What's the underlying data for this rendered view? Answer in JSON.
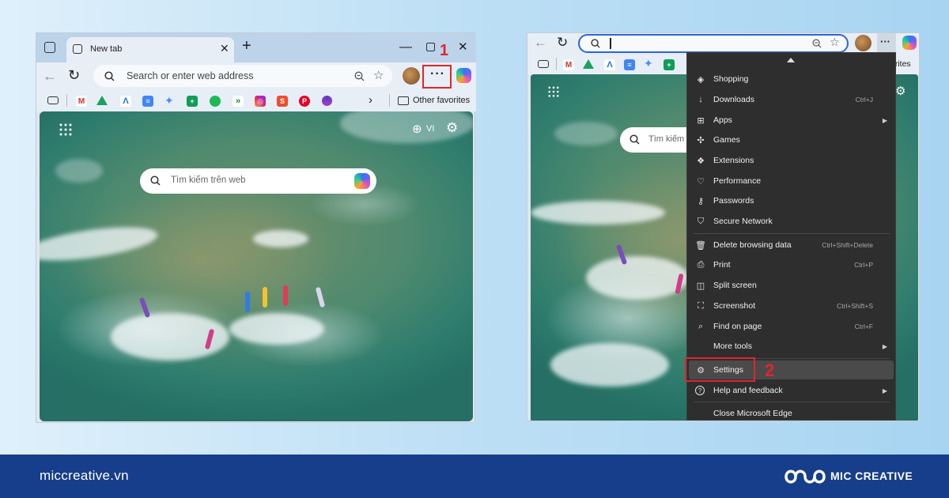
{
  "left_window": {
    "tab_title": "New tab",
    "address_placeholder": "Search or enter web address",
    "other_favorites": "Other favorites",
    "search_placeholder": "Tìm kiếm trên web",
    "language": "VI",
    "step_label": "1"
  },
  "right_window": {
    "search_placeholder": "Tìm kiếm",
    "fav_partial": "orites",
    "step_label": "2",
    "menu": {
      "items": [
        {
          "label": "Shopping",
          "icon": "tag-icon",
          "shortcut": "",
          "submenu": false
        },
        {
          "label": "Downloads",
          "icon": "download-icon",
          "shortcut": "Ctrl+J",
          "submenu": false
        },
        {
          "label": "Apps",
          "icon": "apps-icon",
          "shortcut": "",
          "submenu": true
        },
        {
          "label": "Games",
          "icon": "gamepad-icon",
          "shortcut": "",
          "submenu": false
        },
        {
          "label": "Extensions",
          "icon": "puzzle-icon",
          "shortcut": "",
          "submenu": false
        },
        {
          "label": "Performance",
          "icon": "heartbeat-icon",
          "shortcut": "",
          "submenu": false
        },
        {
          "label": "Passwords",
          "icon": "key-icon",
          "shortcut": "",
          "submenu": false
        },
        {
          "label": "Secure Network",
          "icon": "shield-icon",
          "shortcut": "",
          "submenu": false
        },
        {
          "label": "Delete browsing data",
          "icon": "trash-icon",
          "shortcut": "Ctrl+Shift+Delete",
          "submenu": false
        },
        {
          "label": "Print",
          "icon": "printer-icon",
          "shortcut": "Ctrl+P",
          "submenu": false
        },
        {
          "label": "Split screen",
          "icon": "split-screen-icon",
          "shortcut": "",
          "submenu": false
        },
        {
          "label": "Screenshot",
          "icon": "screenshot-icon",
          "shortcut": "Ctrl+Shift+S",
          "submenu": false
        },
        {
          "label": "Find on page",
          "icon": "find-icon",
          "shortcut": "Ctrl+F",
          "submenu": false
        },
        {
          "label": "More tools",
          "icon": "",
          "shortcut": "",
          "submenu": true
        },
        {
          "label": "Settings",
          "icon": "gear-icon",
          "shortcut": "",
          "submenu": false
        },
        {
          "label": "Help and feedback",
          "icon": "help-icon",
          "shortcut": "",
          "submenu": true
        },
        {
          "label": "Close Microsoft Edge",
          "icon": "",
          "shortcut": "",
          "submenu": false
        }
      ]
    }
  },
  "footer": {
    "website": "miccreative.vn",
    "brand": "MIC CREATIVE"
  },
  "colors": {
    "highlight_red": "#e0262b",
    "menu_bg": "#2e2e2e",
    "footer_bg": "#173e8a"
  }
}
